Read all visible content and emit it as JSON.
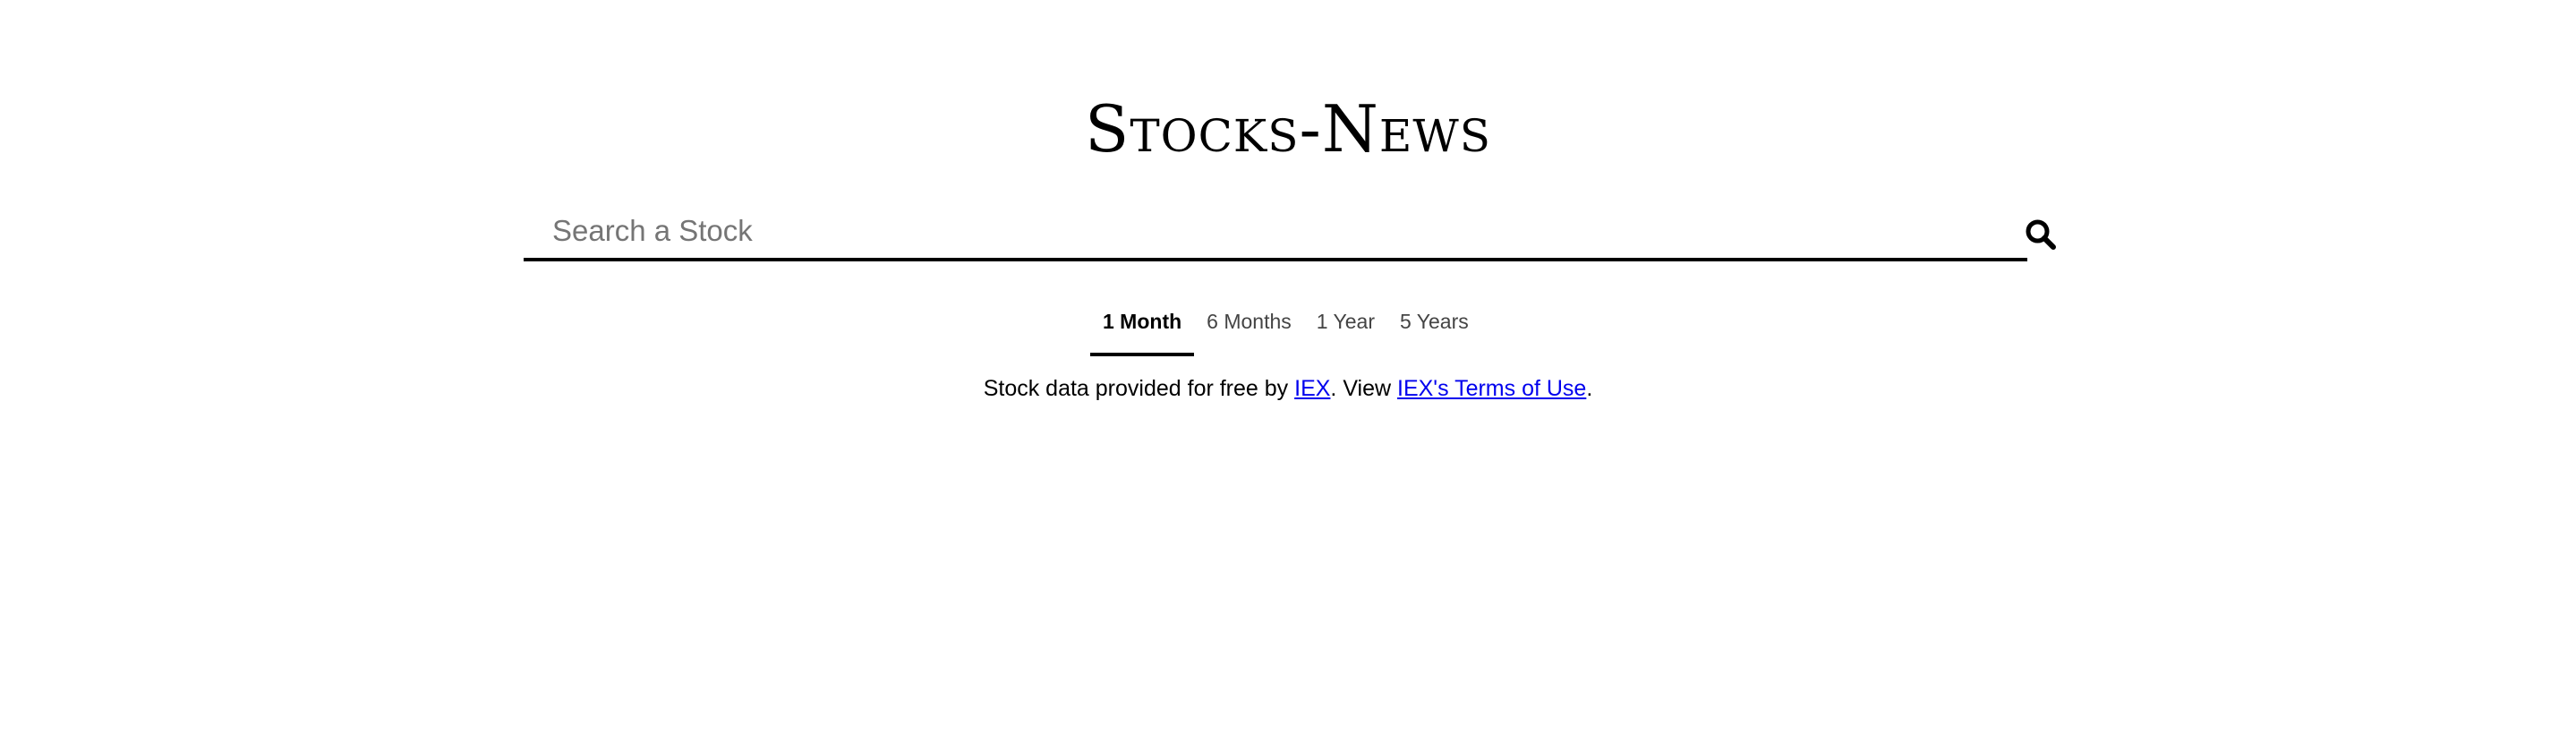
{
  "header": {
    "title": "Stocks-News"
  },
  "search": {
    "placeholder": "Search a Stock",
    "value": "",
    "icon": "search-icon"
  },
  "tabs": [
    {
      "label": "1 Month",
      "active": true
    },
    {
      "label": "6 Months",
      "active": false
    },
    {
      "label": "1 Year",
      "active": false
    },
    {
      "label": "5 Years",
      "active": false
    }
  ],
  "credit": {
    "prefix": "Stock data provided for free by ",
    "link1": "IEX",
    "middle": ". View ",
    "link2": "IEX's Terms of Use",
    "suffix": "."
  },
  "colors": {
    "link": "#0000ee",
    "placeholder": "#757575",
    "text": "#000000"
  }
}
